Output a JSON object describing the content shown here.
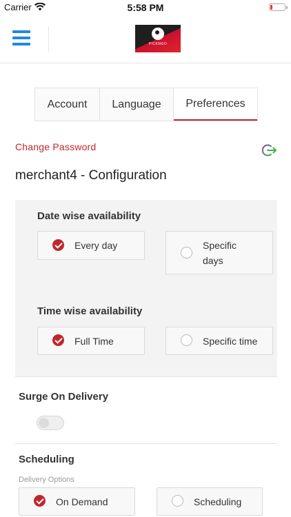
{
  "status_bar": {
    "carrier": "Carrier",
    "time": "5:58 PM"
  },
  "header": {
    "logo_text": "PICKNGO"
  },
  "tabs": [
    {
      "label": "Account",
      "active": false
    },
    {
      "label": "Language",
      "active": false
    },
    {
      "label": "Preferences",
      "active": true
    }
  ],
  "change_password": "Change Password",
  "config_title": "merchant4 - Configuration",
  "date_wise": {
    "label": "Date wise availability",
    "options": [
      {
        "label": "Every day",
        "checked": true
      },
      {
        "label": "Specific days",
        "label_line1": "Specific",
        "label_line2": "days",
        "checked": false
      }
    ]
  },
  "time_wise": {
    "label": "Time wise availability",
    "options": [
      {
        "label": "Full Time",
        "checked": true
      },
      {
        "label": "Specific time",
        "checked": false
      }
    ]
  },
  "surge": {
    "label": "Surge On Delivery",
    "enabled": false
  },
  "scheduling": {
    "label": "Scheduling",
    "delivery_options_label": "Delivery Options",
    "options": [
      {
        "label": "On Demand",
        "checked": true
      },
      {
        "label": "Scheduling",
        "checked": false
      }
    ]
  },
  "colors": {
    "accent": "#c0272d",
    "menu": "#1e88e5"
  },
  "icons": [
    "wifi-icon",
    "battery-icon",
    "menu-icon",
    "logout-icon",
    "check-icon"
  ]
}
